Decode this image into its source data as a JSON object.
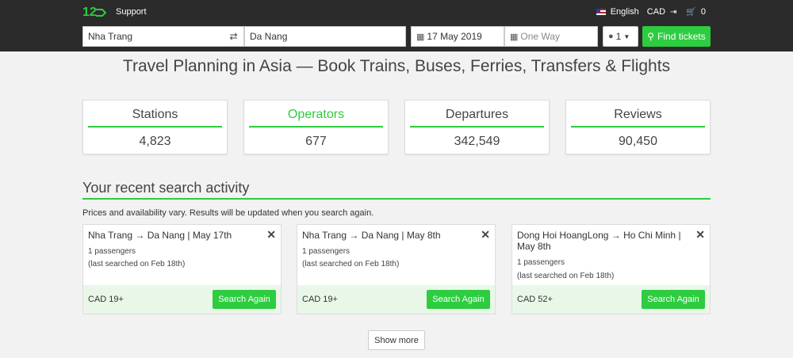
{
  "header": {
    "support_label": "Support",
    "language_label": "English",
    "currency_label": "CAD",
    "cart_count": "0"
  },
  "search": {
    "from_value": "Nha Trang",
    "to_value": "Da Nang",
    "depart_date": "17 May 2019",
    "return_placeholder": "One Way",
    "passengers": "1",
    "find_label": "Find tickets"
  },
  "page_title": "Travel Planning in Asia — Book Trains, Buses, Ferries, Transfers & Flights",
  "stats": [
    {
      "label": "Stations",
      "value": "4,823"
    },
    {
      "label": "Operators",
      "value": "677"
    },
    {
      "label": "Departures",
      "value": "342,549"
    },
    {
      "label": "Reviews",
      "value": "90,450"
    }
  ],
  "recent": {
    "title": "Your recent search activity",
    "note": "Prices and availability vary. Results will be updated when you search again.",
    "cards": [
      {
        "route": "Nha Trang → Da Nang | May 17th",
        "passengers": "1 passengers",
        "last_searched": "(last searched on Feb 18th)",
        "price": "CAD 19+",
        "button": "Search Again"
      },
      {
        "route": "Nha Trang → Da Nang | May 8th",
        "passengers": "1 passengers",
        "last_searched": "(last searched on Feb 18th)",
        "price": "CAD 19+",
        "button": "Search Again"
      },
      {
        "route": "Dong Hoi HoangLong → Ho Chi Minh | May 8th",
        "passengers": "1 passengers",
        "last_searched": "(last searched on Feb 18th)",
        "price": "CAD 52+",
        "button": "Search Again"
      }
    ],
    "show_more": "Show more"
  },
  "colors": {
    "accent": "#2ecc40",
    "header_bg": "#2b2b2b"
  }
}
